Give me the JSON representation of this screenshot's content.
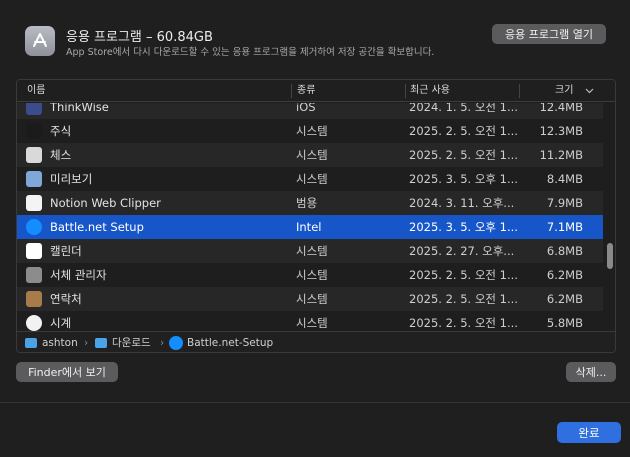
{
  "header": {
    "title": "응용 프로그램 – 60.84GB",
    "description": "App Store에서 다시 다운로드할 수 있는 응용 프로그램을 제거하여 저장 공간을 확보합니다.",
    "open_button": "응용 프로그램 열기"
  },
  "columns": {
    "name": "이름",
    "kind": "종류",
    "last_used": "최근 사용",
    "size": "크기"
  },
  "rows": [
    {
      "name": "ThinkWise",
      "kind": "iOS",
      "last_used": "2024. 1. 5. 오전 1...",
      "size": "12.4MB",
      "icon": "thinkwise-icon",
      "color": "#3b4b8c"
    },
    {
      "name": "주식",
      "kind": "시스템",
      "last_used": "2025. 2. 5. 오전 1...",
      "size": "12.3MB",
      "icon": "stocks-icon",
      "color": "#1b1b1b"
    },
    {
      "name": "체스",
      "kind": "시스템",
      "last_used": "2025. 2. 5. 오전 1...",
      "size": "11.2MB",
      "icon": "chess-icon",
      "color": "#d9d9d9"
    },
    {
      "name": "미리보기",
      "kind": "시스템",
      "last_used": "2025. 3. 5. 오후 1...",
      "size": "8.4MB",
      "icon": "preview-icon",
      "color": "#7fa7d8"
    },
    {
      "name": "Notion Web Clipper",
      "kind": "범용",
      "last_used": "2024. 3. 11. 오후...",
      "size": "7.9MB",
      "icon": "notion-icon",
      "color": "#f4f4f4"
    },
    {
      "name": "Battle.net Setup",
      "kind": "Intel",
      "last_used": "2025. 3. 5. 오후 1...",
      "size": "7.1MB",
      "icon": "battlenet-icon",
      "color": "#148eff"
    },
    {
      "name": "캘린더",
      "kind": "시스템",
      "last_used": "2025. 2. 27. 오후...",
      "size": "6.8MB",
      "icon": "calendar-icon",
      "color": "#ffffff"
    },
    {
      "name": "서체 관리자",
      "kind": "시스템",
      "last_used": "2025. 2. 5. 오전 1...",
      "size": "6.2MB",
      "icon": "font-book-icon",
      "color": "#8c8c8c"
    },
    {
      "name": "연락처",
      "kind": "시스템",
      "last_used": "2025. 2. 5. 오전 1...",
      "size": "6.2MB",
      "icon": "contacts-icon",
      "color": "#a77b4a"
    },
    {
      "name": "시계",
      "kind": "시스템",
      "last_used": "2025. 2. 5. 오전 1...",
      "size": "5.8MB",
      "icon": "clock-icon",
      "color": "#f2f2f2"
    }
  ],
  "pathbar": {
    "home": "ashton",
    "downloads": "다운로드",
    "file": "Battle.net-Setup"
  },
  "footer": {
    "finder_button": "Finder에서 보기",
    "delete_button": "삭제...",
    "done_button": "완료"
  }
}
